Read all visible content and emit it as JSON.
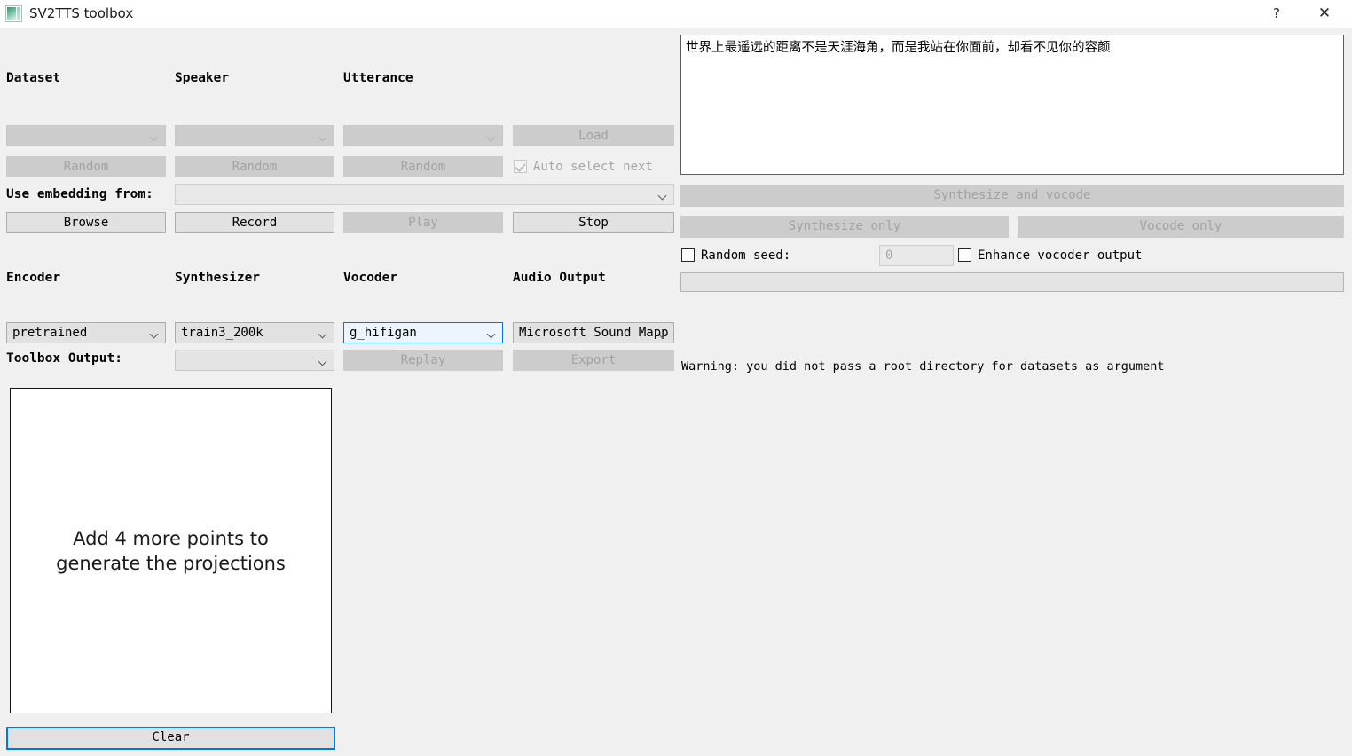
{
  "window": {
    "title": "SV2TTS toolbox",
    "icon": "app-icon",
    "help_label": "?",
    "close_label": "✕"
  },
  "left_panel": {
    "headers": {
      "dataset": "Dataset",
      "speaker": "Speaker",
      "utterance": "Utterance"
    },
    "combos": {
      "dataset": "",
      "speaker": "",
      "utterance": ""
    },
    "buttons": {
      "load": "Load",
      "random_dataset": "Random",
      "random_speaker": "Random",
      "random_utterance": "Random",
      "browse": "Browse",
      "record": "Record",
      "play": "Play",
      "stop": "Stop"
    },
    "auto_select": {
      "label": "Auto select next",
      "checked": true,
      "enabled": false
    },
    "use_embedding": {
      "label": "Use embedding from:",
      "value": ""
    },
    "model_headers": {
      "encoder": "Encoder",
      "synthesizer": "Synthesizer",
      "vocoder": "Vocoder",
      "audio_output": "Audio Output"
    },
    "model_values": {
      "encoder": "pretrained",
      "synthesizer": "train3_200k",
      "vocoder": "g_hifigan",
      "audio_output": "Microsoft Sound Mapp"
    },
    "toolbox_output": {
      "label": "Toolbox Output:",
      "value": ""
    },
    "replay_label": "Replay",
    "export_label": "Export",
    "projection_message": "Add 4 more points to\ngenerate the projections",
    "clear_label": "Clear"
  },
  "right_panel": {
    "text_input": "世界上最遥远的距离不是天涯海角，而是我站在你面前，却看不见你的容颜",
    "synthesize_and_vocode": "Synthesize and vocode",
    "synthesize_only": "Synthesize only",
    "vocode_only": "Vocode only",
    "random_seed": {
      "label": "Random seed:",
      "checked": false,
      "value_placeholder": "0"
    },
    "enhance_vocoder": {
      "label": "Enhance vocoder output",
      "checked": false
    },
    "progress_value": "",
    "warning": "Warning: you did not pass a root directory for datasets as argument"
  },
  "colors": {
    "window_bg": "#f0f0f0",
    "accent_focus": "#0078d7",
    "disabled_bg": "#cccccc",
    "enabled_bg": "#e1e1e1"
  }
}
